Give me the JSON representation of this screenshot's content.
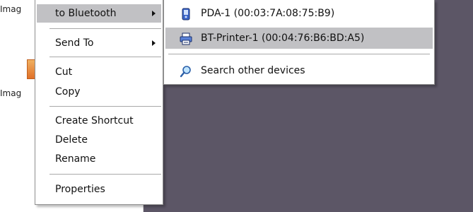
{
  "explorer": {
    "file_label_top": "Imag",
    "file_label_bottom": "Imag"
  },
  "context_menu": {
    "items": [
      {
        "label": "to Bluetooth",
        "has_submenu": true,
        "highlighted": true
      },
      {
        "label": "Send To",
        "has_submenu": true
      },
      {
        "label": "Cut"
      },
      {
        "label": "Copy"
      },
      {
        "label": "Create Shortcut"
      },
      {
        "label": "Delete"
      },
      {
        "label": "Rename"
      },
      {
        "label": "Properties"
      }
    ]
  },
  "bluetooth_submenu": {
    "devices": [
      {
        "label": "PDA-1 (00:03:7A:08:75:B9)",
        "icon": "pda-icon"
      },
      {
        "label": "BT-Printer-1 (00:04:76:B6:BD:A5)",
        "icon": "printer-icon",
        "highlighted": true
      }
    ],
    "search_label": "Search other devices",
    "search_icon": "search-icon"
  },
  "colors": {
    "desktop": "#5c5666",
    "highlight": "#c1c1c4",
    "menu_border": "#8e8e8e"
  }
}
